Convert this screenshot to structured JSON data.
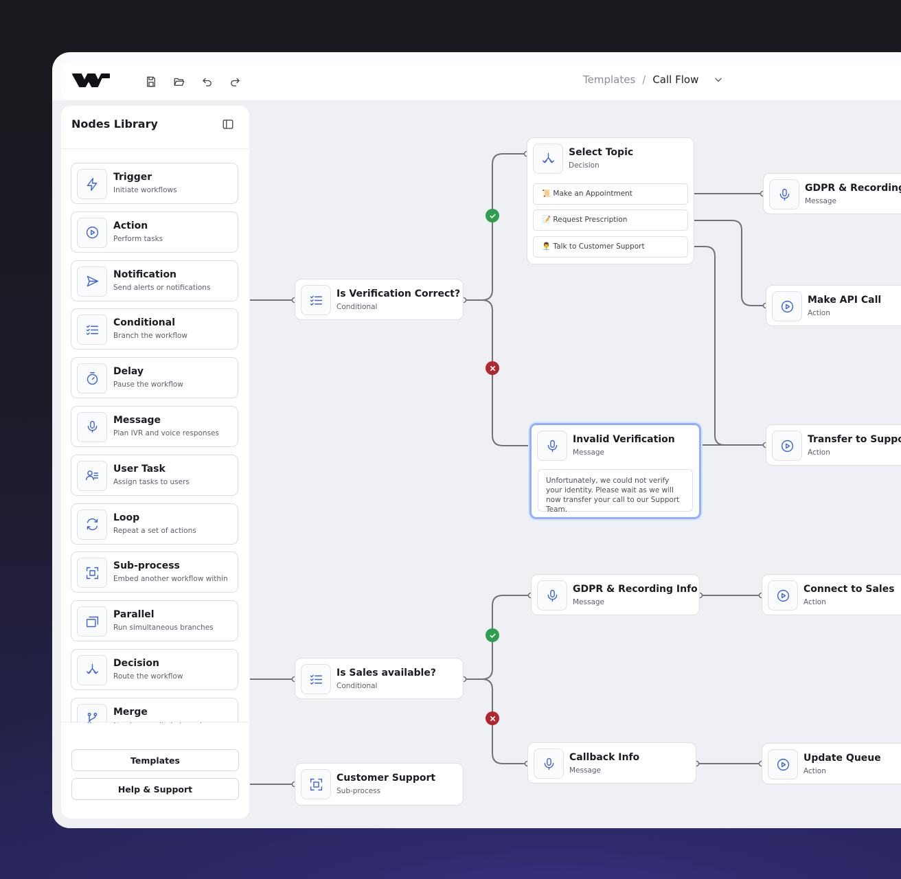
{
  "toolbar": {
    "breadcrumb_root": "Templates",
    "breadcrumb_sep": "/",
    "breadcrumb_current": "Call Flow"
  },
  "sidebar": {
    "title": "Nodes Library",
    "items": [
      {
        "title": "Trigger",
        "desc": "Initiate workflows",
        "icon": "bolt-icon"
      },
      {
        "title": "Action",
        "desc": "Perform tasks",
        "icon": "play-circle-icon"
      },
      {
        "title": "Notification",
        "desc": "Send alerts or notifications",
        "icon": "send-icon"
      },
      {
        "title": "Conditional",
        "desc": "Branch the workflow",
        "icon": "checklist-icon"
      },
      {
        "title": "Delay",
        "desc": "Pause the workflow",
        "icon": "timer-icon"
      },
      {
        "title": "Message",
        "desc": "Plan IVR and voice responses",
        "icon": "microphone-icon"
      },
      {
        "title": "User Task",
        "desc": "Assign tasks to users",
        "icon": "user-list-icon"
      },
      {
        "title": "Loop",
        "desc": "Repeat a set of actions",
        "icon": "loop-icon"
      },
      {
        "title": "Sub-process",
        "desc": "Embed another workflow within",
        "icon": "subprocess-icon"
      },
      {
        "title": "Parallel",
        "desc": "Run simultaneous branches",
        "icon": "parallel-icon"
      },
      {
        "title": "Decision",
        "desc": "Route the workflow",
        "icon": "decision-icon"
      },
      {
        "title": "Merge",
        "desc": "Combine multiple branches",
        "icon": "merge-icon"
      }
    ],
    "templates_label": "Templates",
    "help_label": "Help & Support"
  },
  "nodes": {
    "verify": {
      "title": "Is Verification Correct?",
      "type": "Conditional"
    },
    "select_topic": {
      "title": "Select Topic",
      "type": "Decision",
      "options": [
        "📜 Make an Appointment",
        "📝 Request Prescription",
        "👨‍💼 Talk to Customer Support"
      ]
    },
    "gdpr_top": {
      "title": "GDPR & Recording In",
      "type": "Message"
    },
    "api_call": {
      "title": "Make API Call",
      "type": "Action"
    },
    "invalid": {
      "title": "Invalid Verification",
      "type": "Message",
      "body": "Unfortunately, we could not verify your identity. Please wait as we will now transfer your call to our Support Team."
    },
    "transfer": {
      "title": "Transfer to Support",
      "type": "Action"
    },
    "gdpr_bottom": {
      "title": "GDPR & Recording Info",
      "type": "Message"
    },
    "connect_sales": {
      "title": "Connect to Sales",
      "type": "Action"
    },
    "sales_avail": {
      "title": "Is Sales available?",
      "type": "Conditional"
    },
    "callback": {
      "title": "Callback Info",
      "type": "Message"
    },
    "update_queue": {
      "title": "Update Queue",
      "type": "Action"
    },
    "customer_support": {
      "title": "Customer Support",
      "type": "Sub-process"
    }
  },
  "colors": {
    "accent": "#3b63d8",
    "success": "#2f9e4f",
    "failure": "#b2272f",
    "wire": "#70727b"
  }
}
